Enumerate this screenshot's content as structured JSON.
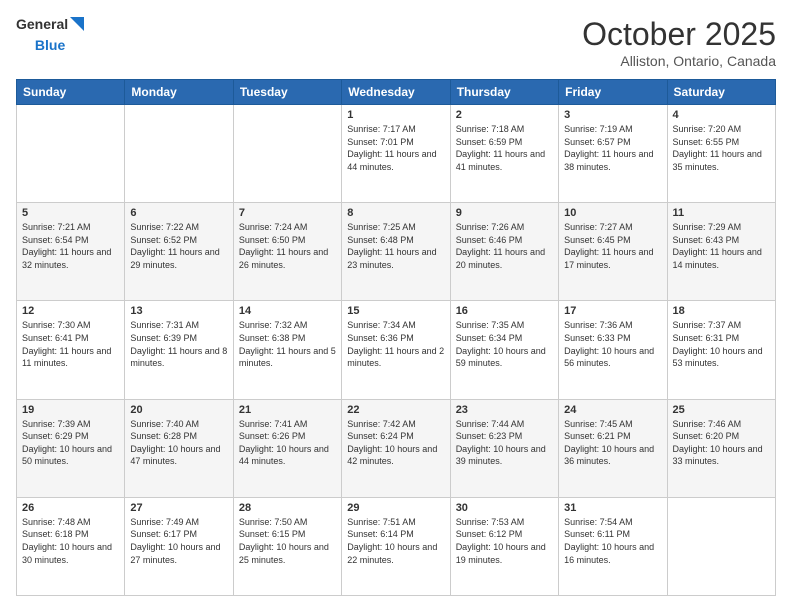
{
  "header": {
    "logo_line1": "General",
    "logo_line2": "Blue",
    "title": "October 2025",
    "subtitle": "Alliston, Ontario, Canada"
  },
  "days_of_week": [
    "Sunday",
    "Monday",
    "Tuesday",
    "Wednesday",
    "Thursday",
    "Friday",
    "Saturday"
  ],
  "weeks": [
    [
      {
        "day": "",
        "info": ""
      },
      {
        "day": "",
        "info": ""
      },
      {
        "day": "",
        "info": ""
      },
      {
        "day": "1",
        "info": "Sunrise: 7:17 AM\nSunset: 7:01 PM\nDaylight: 11 hours and 44 minutes."
      },
      {
        "day": "2",
        "info": "Sunrise: 7:18 AM\nSunset: 6:59 PM\nDaylight: 11 hours and 41 minutes."
      },
      {
        "day": "3",
        "info": "Sunrise: 7:19 AM\nSunset: 6:57 PM\nDaylight: 11 hours and 38 minutes."
      },
      {
        "day": "4",
        "info": "Sunrise: 7:20 AM\nSunset: 6:55 PM\nDaylight: 11 hours and 35 minutes."
      }
    ],
    [
      {
        "day": "5",
        "info": "Sunrise: 7:21 AM\nSunset: 6:54 PM\nDaylight: 11 hours and 32 minutes."
      },
      {
        "day": "6",
        "info": "Sunrise: 7:22 AM\nSunset: 6:52 PM\nDaylight: 11 hours and 29 minutes."
      },
      {
        "day": "7",
        "info": "Sunrise: 7:24 AM\nSunset: 6:50 PM\nDaylight: 11 hours and 26 minutes."
      },
      {
        "day": "8",
        "info": "Sunrise: 7:25 AM\nSunset: 6:48 PM\nDaylight: 11 hours and 23 minutes."
      },
      {
        "day": "9",
        "info": "Sunrise: 7:26 AM\nSunset: 6:46 PM\nDaylight: 11 hours and 20 minutes."
      },
      {
        "day": "10",
        "info": "Sunrise: 7:27 AM\nSunset: 6:45 PM\nDaylight: 11 hours and 17 minutes."
      },
      {
        "day": "11",
        "info": "Sunrise: 7:29 AM\nSunset: 6:43 PM\nDaylight: 11 hours and 14 minutes."
      }
    ],
    [
      {
        "day": "12",
        "info": "Sunrise: 7:30 AM\nSunset: 6:41 PM\nDaylight: 11 hours and 11 minutes."
      },
      {
        "day": "13",
        "info": "Sunrise: 7:31 AM\nSunset: 6:39 PM\nDaylight: 11 hours and 8 minutes."
      },
      {
        "day": "14",
        "info": "Sunrise: 7:32 AM\nSunset: 6:38 PM\nDaylight: 11 hours and 5 minutes."
      },
      {
        "day": "15",
        "info": "Sunrise: 7:34 AM\nSunset: 6:36 PM\nDaylight: 11 hours and 2 minutes."
      },
      {
        "day": "16",
        "info": "Sunrise: 7:35 AM\nSunset: 6:34 PM\nDaylight: 10 hours and 59 minutes."
      },
      {
        "day": "17",
        "info": "Sunrise: 7:36 AM\nSunset: 6:33 PM\nDaylight: 10 hours and 56 minutes."
      },
      {
        "day": "18",
        "info": "Sunrise: 7:37 AM\nSunset: 6:31 PM\nDaylight: 10 hours and 53 minutes."
      }
    ],
    [
      {
        "day": "19",
        "info": "Sunrise: 7:39 AM\nSunset: 6:29 PM\nDaylight: 10 hours and 50 minutes."
      },
      {
        "day": "20",
        "info": "Sunrise: 7:40 AM\nSunset: 6:28 PM\nDaylight: 10 hours and 47 minutes."
      },
      {
        "day": "21",
        "info": "Sunrise: 7:41 AM\nSunset: 6:26 PM\nDaylight: 10 hours and 44 minutes."
      },
      {
        "day": "22",
        "info": "Sunrise: 7:42 AM\nSunset: 6:24 PM\nDaylight: 10 hours and 42 minutes."
      },
      {
        "day": "23",
        "info": "Sunrise: 7:44 AM\nSunset: 6:23 PM\nDaylight: 10 hours and 39 minutes."
      },
      {
        "day": "24",
        "info": "Sunrise: 7:45 AM\nSunset: 6:21 PM\nDaylight: 10 hours and 36 minutes."
      },
      {
        "day": "25",
        "info": "Sunrise: 7:46 AM\nSunset: 6:20 PM\nDaylight: 10 hours and 33 minutes."
      }
    ],
    [
      {
        "day": "26",
        "info": "Sunrise: 7:48 AM\nSunset: 6:18 PM\nDaylight: 10 hours and 30 minutes."
      },
      {
        "day": "27",
        "info": "Sunrise: 7:49 AM\nSunset: 6:17 PM\nDaylight: 10 hours and 27 minutes."
      },
      {
        "day": "28",
        "info": "Sunrise: 7:50 AM\nSunset: 6:15 PM\nDaylight: 10 hours and 25 minutes."
      },
      {
        "day": "29",
        "info": "Sunrise: 7:51 AM\nSunset: 6:14 PM\nDaylight: 10 hours and 22 minutes."
      },
      {
        "day": "30",
        "info": "Sunrise: 7:53 AM\nSunset: 6:12 PM\nDaylight: 10 hours and 19 minutes."
      },
      {
        "day": "31",
        "info": "Sunrise: 7:54 AM\nSunset: 6:11 PM\nDaylight: 10 hours and 16 minutes."
      },
      {
        "day": "",
        "info": ""
      }
    ]
  ]
}
